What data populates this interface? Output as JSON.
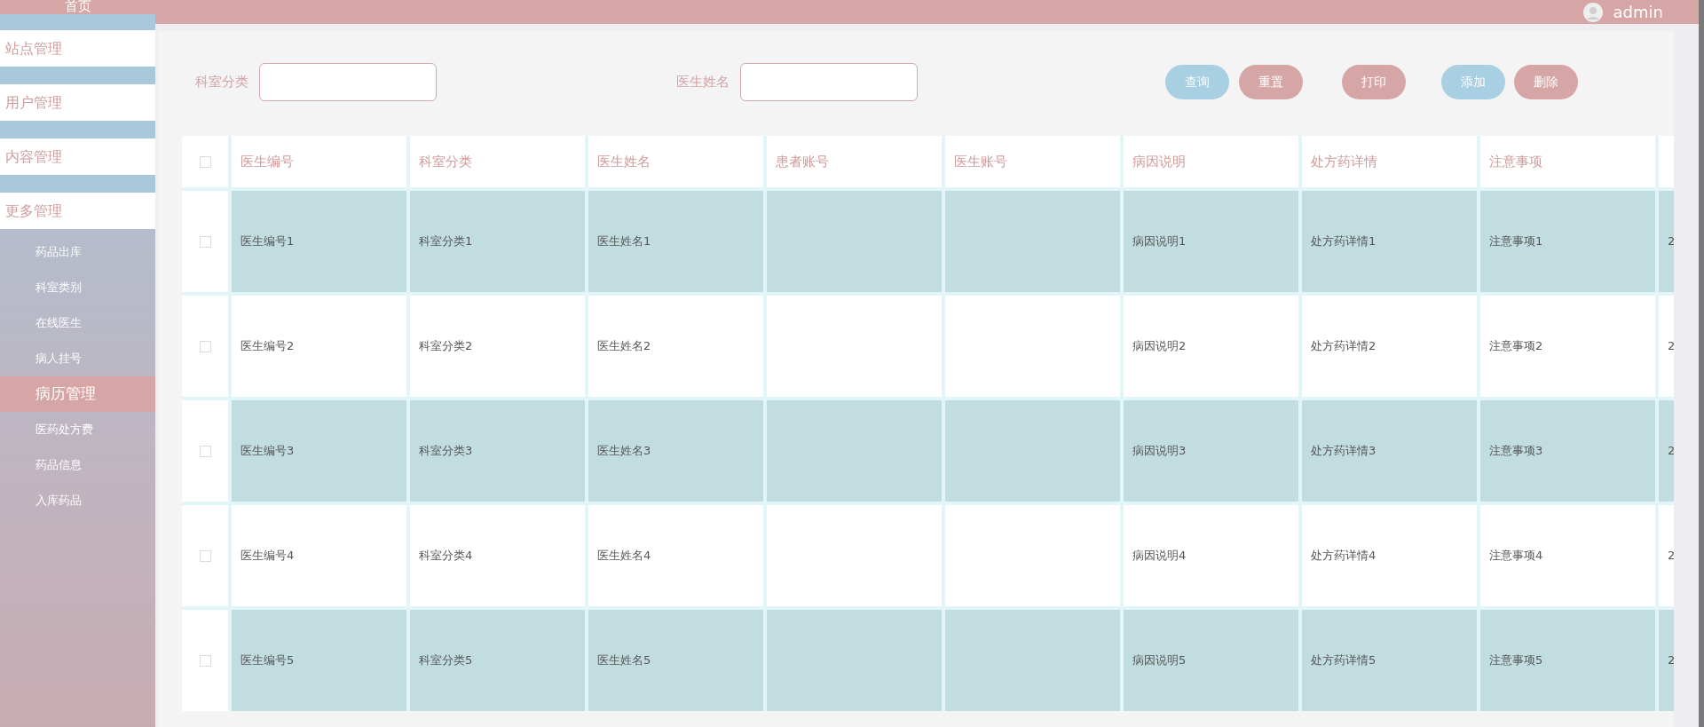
{
  "sidebar": {
    "home": "首页",
    "menus": [
      {
        "label": "站点管理"
      },
      {
        "label": "用户管理"
      },
      {
        "label": "内容管理"
      },
      {
        "label": "更多管理"
      }
    ],
    "submenu": [
      {
        "label": "药品出库",
        "selected": false
      },
      {
        "label": "科室类别",
        "selected": false
      },
      {
        "label": "在线医生",
        "selected": false
      },
      {
        "label": "病人挂号",
        "selected": false
      },
      {
        "label": "病历管理",
        "selected": true
      },
      {
        "label": "医药处方费",
        "selected": false
      },
      {
        "label": "药品信息",
        "selected": false
      },
      {
        "label": "入库药品",
        "selected": false
      }
    ]
  },
  "header": {
    "user": "admin"
  },
  "search": {
    "fields": [
      {
        "label": "科室分类"
      },
      {
        "label": "医生姓名"
      }
    ],
    "buttons": [
      {
        "label": "查询",
        "kind": "primary"
      },
      {
        "label": "重置",
        "kind": "danger"
      },
      {
        "label": "打印",
        "kind": "danger"
      },
      {
        "label": "添加",
        "kind": "primary"
      },
      {
        "label": "删除",
        "kind": "danger"
      }
    ]
  },
  "table": {
    "select_all": {
      "checked": false
    },
    "columns": [
      "医生编号",
      "科室分类",
      "医生姓名",
      "患者账号",
      "医生账号",
      "病因说明",
      "处方药详情",
      "注意事项"
    ],
    "rows": [
      {
        "checked": false,
        "cells": [
          "医生编号1",
          "科室分类1",
          "医生姓名1",
          "",
          "",
          "病因说明1",
          "处方药详情1",
          "注意事项1",
          "2"
        ]
      },
      {
        "checked": false,
        "cells": [
          "医生编号2",
          "科室分类2",
          "医生姓名2",
          "",
          "",
          "病因说明2",
          "处方药详情2",
          "注意事项2",
          "2"
        ]
      },
      {
        "checked": false,
        "cells": [
          "医生编号3",
          "科室分类3",
          "医生姓名3",
          "",
          "",
          "病因说明3",
          "处方药详情3",
          "注意事项3",
          "2"
        ]
      },
      {
        "checked": false,
        "cells": [
          "医生编号4",
          "科室分类4",
          "医生姓名4",
          "",
          "",
          "病因说明4",
          "处方药详情4",
          "注意事项4",
          "2"
        ]
      },
      {
        "checked": false,
        "cells": [
          "医生编号5",
          "科室分类5",
          "医生姓名5",
          "",
          "",
          "病因说明5",
          "处方药详情5",
          "注意事项5",
          "2"
        ]
      }
    ]
  }
}
